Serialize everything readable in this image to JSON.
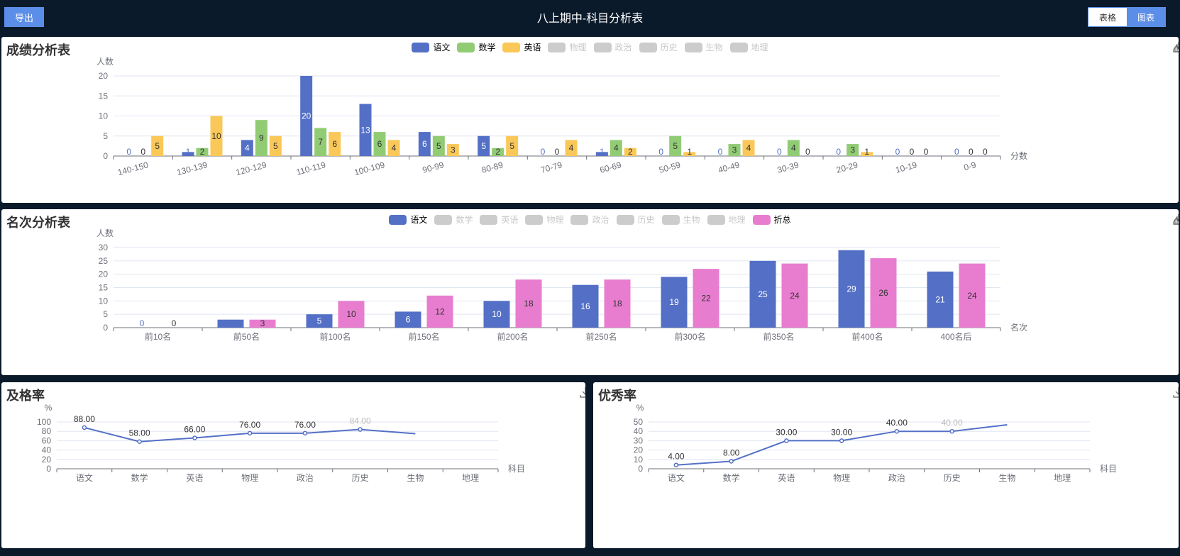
{
  "header": {
    "export_label": "导出",
    "title": "八上期中-科目分析表",
    "view_table_label": "表格",
    "view_chart_label": "图表"
  },
  "toolbox_icons": [
    "bar-chart-icon",
    "line-chart-icon",
    "download-icon"
  ],
  "colors": {
    "语文": "#5470c6",
    "数学": "#91cc75",
    "英语": "#fac858",
    "折总": "#e87dd0",
    "off": "#cccccc",
    "axis": "#6e7079",
    "grid": "#e0e6f1"
  },
  "score_panel": {
    "title": "成绩分析表",
    "chart_data": {
      "type": "bar",
      "ylabel": "人数",
      "xlabel": "分数",
      "ylim": [
        0,
        20
      ],
      "yticks": [
        0,
        5,
        10,
        15,
        20
      ],
      "categories": [
        "140-150",
        "130-139",
        "120-129",
        "110-119",
        "100-109",
        "90-99",
        "80-89",
        "70-79",
        "60-69",
        "50-59",
        "40-49",
        "30-39",
        "20-29",
        "10-19",
        "0-9"
      ],
      "legend": [
        {
          "name": "语文",
          "on": true
        },
        {
          "name": "数学",
          "on": true
        },
        {
          "name": "英语",
          "on": true
        },
        {
          "name": "物理",
          "on": false
        },
        {
          "name": "政治",
          "on": false
        },
        {
          "name": "历史",
          "on": false
        },
        {
          "name": "生物",
          "on": false
        },
        {
          "name": "地理",
          "on": false
        }
      ],
      "series": [
        {
          "name": "语文",
          "values": [
            0,
            1,
            4,
            20,
            13,
            6,
            5,
            0,
            1,
            0,
            0,
            0,
            0,
            0,
            0
          ]
        },
        {
          "name": "数学",
          "values": [
            0,
            2,
            9,
            7,
            6,
            5,
            2,
            0,
            4,
            5,
            3,
            4,
            3,
            0,
            0
          ]
        },
        {
          "name": "英语",
          "values": [
            5,
            10,
            5,
            6,
            4,
            3,
            5,
            4,
            2,
            1,
            4,
            0,
            1,
            0,
            0
          ]
        }
      ]
    }
  },
  "rank_panel": {
    "title": "名次分析表",
    "chart_data": {
      "type": "bar",
      "ylabel": "人数",
      "xlabel": "名次",
      "ylim": [
        0,
        30
      ],
      "yticks": [
        0,
        5,
        10,
        15,
        20,
        25,
        30
      ],
      "categories": [
        "前10名",
        "前50名",
        "前100名",
        "前150名",
        "前200名",
        "前250名",
        "前300名",
        "前350名",
        "前400名",
        "400名后"
      ],
      "legend": [
        {
          "name": "语文",
          "on": true
        },
        {
          "name": "数学",
          "on": false
        },
        {
          "name": "英语",
          "on": false
        },
        {
          "name": "物理",
          "on": false
        },
        {
          "name": "政治",
          "on": false
        },
        {
          "name": "历史",
          "on": false
        },
        {
          "name": "生物",
          "on": false
        },
        {
          "name": "地理",
          "on": false
        },
        {
          "name": "折总",
          "on": true
        }
      ],
      "series": [
        {
          "name": "语文",
          "values": [
            0,
            3,
            5,
            6,
            10,
            16,
            19,
            25,
            29,
            21
          ]
        },
        {
          "name": "折总",
          "values": [
            0,
            3,
            10,
            12,
            18,
            18,
            22,
            24,
            26,
            24
          ]
        }
      ]
    }
  },
  "pass_panel": {
    "title": "及格率",
    "chart_data": {
      "type": "line",
      "ylabel": "%",
      "xlabel": "科目",
      "ylim": [
        0,
        100
      ],
      "yticks": [
        0,
        20,
        40,
        60,
        80,
        100
      ],
      "categories": [
        "语文",
        "数学",
        "英语",
        "物理",
        "政治",
        "历史",
        "生物",
        "地理"
      ],
      "series": [
        {
          "values": [
            88,
            58,
            66,
            76,
            76,
            84,
            75,
            null
          ]
        }
      ],
      "point_labels": [
        "88.00",
        "58.00",
        "66.00",
        "76.00",
        "76.00",
        "84.00",
        "",
        ""
      ]
    }
  },
  "excellent_panel": {
    "title": "优秀率",
    "chart_data": {
      "type": "line",
      "ylabel": "%",
      "xlabel": "科目",
      "ylim": [
        0,
        50
      ],
      "yticks": [
        0,
        10,
        20,
        30,
        40,
        50
      ],
      "categories": [
        "语文",
        "数学",
        "英语",
        "物理",
        "政治",
        "历史",
        "生物",
        "地理"
      ],
      "series": [
        {
          "values": [
            4,
            8,
            30,
            30,
            40,
            40,
            47,
            null
          ]
        }
      ],
      "point_labels": [
        "4.00",
        "8.00",
        "30.00",
        "30.00",
        "40.00",
        "40.00",
        "",
        ""
      ]
    }
  }
}
